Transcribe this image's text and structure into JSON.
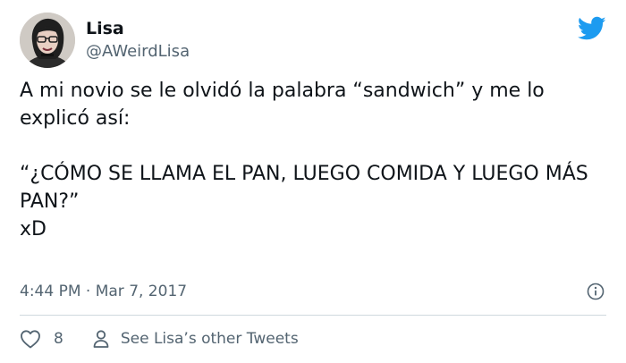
{
  "user": {
    "name": "Lisa",
    "handle": "@AWeirdLisa"
  },
  "tweet": {
    "text": "A mi novio se le olvidó la palabra “sandwich” y me lo explicó así:\n\n“¿CÓMO SE LLAMA EL PAN, LUEGO COMIDA Y LUEGO MÁS PAN?”\nxD",
    "timestamp": "4:44 PM · Mar 7, 2017"
  },
  "actions": {
    "likes": "8",
    "profile_link": "See Lisa’s other Tweets"
  },
  "icons": {
    "logo": "twitter-bird-icon",
    "info": "info-icon",
    "like": "heart-icon",
    "profile": "person-icon"
  },
  "colors": {
    "brand": "#1d9bf0",
    "secondary_text": "#536471"
  }
}
